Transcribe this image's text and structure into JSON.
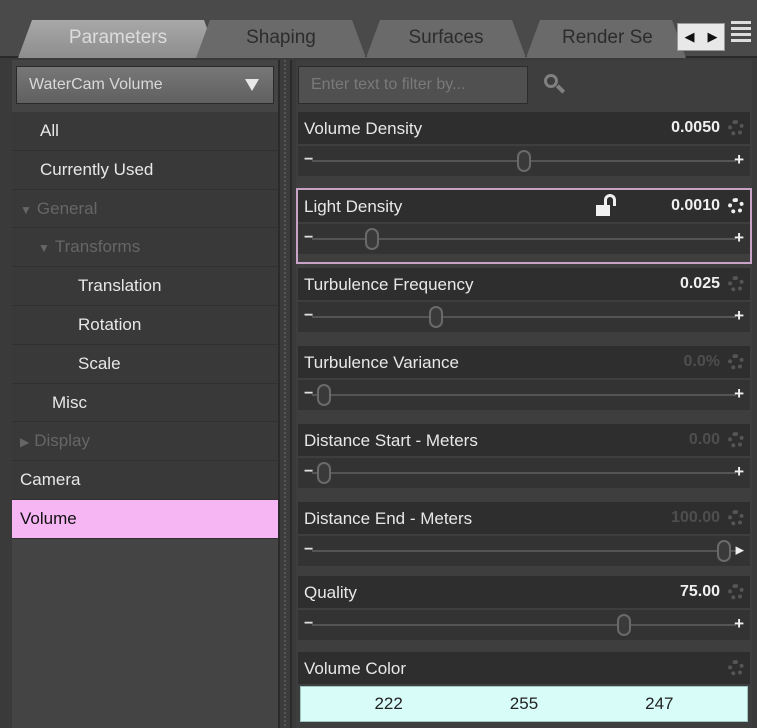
{
  "tabs": [
    {
      "label": "Parameters",
      "active": true
    },
    {
      "label": "Shaping",
      "active": false
    },
    {
      "label": "Surfaces",
      "active": false
    },
    {
      "label": "Render Se",
      "active": false
    }
  ],
  "left": {
    "dropdown": "WaterCam Volume",
    "items": [
      {
        "label": "All"
      },
      {
        "label": "Currently Used"
      },
      {
        "label": "General"
      },
      {
        "label": "Transforms"
      },
      {
        "label": "Translation"
      },
      {
        "label": "Rotation"
      },
      {
        "label": "Scale"
      },
      {
        "label": "Misc"
      },
      {
        "label": "Display"
      },
      {
        "label": "Camera"
      },
      {
        "label": "Volume",
        "selected": true
      }
    ]
  },
  "right": {
    "filter_placeholder": "Enter text to filter by...",
    "params": [
      {
        "label": "Volume Density",
        "value": "0.0050",
        "level": 0.5
      },
      {
        "label": "Light Density",
        "value": "0.0010",
        "level": 0.12
      },
      {
        "label": "Turbulence Frequency",
        "value": "0.025",
        "level": 0.28
      },
      {
        "label": "Turbulence Variance",
        "value": "0.0%",
        "level": 0.0
      },
      {
        "label": "Distance Start - Meters",
        "value": "0.00",
        "level": 0.0
      },
      {
        "label": "Distance End - Meters",
        "value": "100.00",
        "level": 1.0
      },
      {
        "label": "Quality",
        "value": "75.00",
        "level": 0.75
      }
    ],
    "color": {
      "label": "Volume Color",
      "r": "222",
      "g": "255",
      "b": "247"
    }
  }
}
